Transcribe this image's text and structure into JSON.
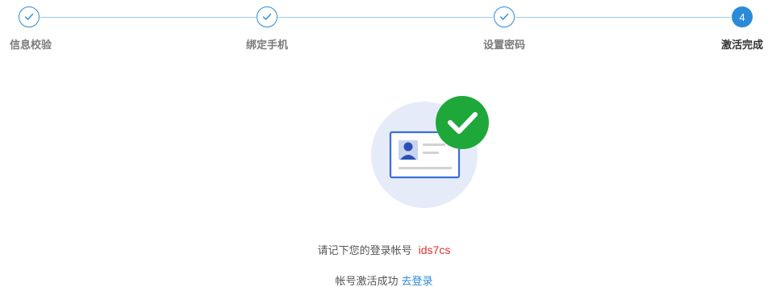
{
  "steps": [
    {
      "label": "信息校验",
      "status": "done"
    },
    {
      "label": "绑定手机",
      "status": "done"
    },
    {
      "label": "设置密码",
      "status": "done"
    },
    {
      "label": "激活完成",
      "status": "active",
      "number": "4"
    }
  ],
  "result": {
    "account_prompt": "请记下您的登录帐号",
    "username": "ids7cs",
    "success_text": "帐号激活成功",
    "login_link": "去登录"
  },
  "icons": {
    "done": "check-icon",
    "illustration": "id-card-success-icon"
  },
  "colors": {
    "accent": "#2b8bd8",
    "success": "#1fa83a",
    "username": "#e03030"
  }
}
